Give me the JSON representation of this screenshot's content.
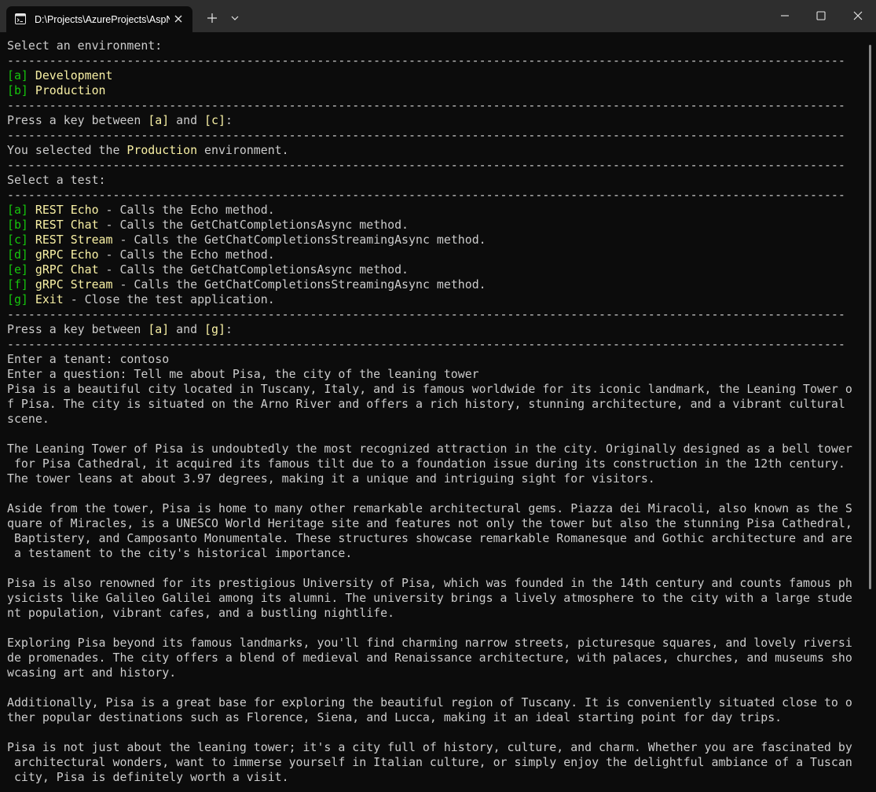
{
  "window": {
    "tab_title": "D:\\Projects\\AzureProjects\\AspNetCore.Chat",
    "icons": {
      "tab": "terminal-icon",
      "tab_close": "close-icon",
      "new_tab": "plus-icon",
      "dropdown": "chevron-down-icon",
      "minimize": "minimize-icon",
      "maximize": "maximize-icon",
      "close": "close-icon"
    },
    "colors": {
      "titlebar": "#2e2e2e",
      "background": "#0c0c0c",
      "text": "#cccccc",
      "key": "#16c60c",
      "highlight": "#f9f1a5"
    }
  },
  "console": {
    "separator": "-----------------------------------------------------------------------------------------------------------------------",
    "env_prompt": "Select an environment:",
    "environments": [
      {
        "key": "[a]",
        "name": "Development"
      },
      {
        "key": "[b]",
        "name": "Production"
      }
    ],
    "env_key_prompt": {
      "before": "Press a key between ",
      "first": "[a]",
      "mid": " and ",
      "last": "[c]",
      "after": ":"
    },
    "selected_env": {
      "before": "You selected the ",
      "value": "Production",
      "after": " environment."
    },
    "test_prompt": "Select a test:",
    "tests": [
      {
        "key": "[a]",
        "name": "REST Echo",
        "desc": " - Calls the Echo method."
      },
      {
        "key": "[b]",
        "name": "REST Chat",
        "desc": " - Calls the GetChatCompletionsAsync method."
      },
      {
        "key": "[c]",
        "name": "REST Stream",
        "desc": " - Calls the GetChatCompletionsStreamingAsync method."
      },
      {
        "key": "[d]",
        "name": "gRPC Echo",
        "desc": " - Calls the Echo method."
      },
      {
        "key": "[e]",
        "name": "gRPC Chat",
        "desc": " - Calls the GetChatCompletionsAsync method."
      },
      {
        "key": "[f]",
        "name": "gRPC Stream",
        "desc": " - Calls the GetChatCompletionsStreamingAsync method."
      },
      {
        "key": "[g]",
        "name": "Exit",
        "desc": " - Close the test application."
      }
    ],
    "test_key_prompt": {
      "before": "Press a key between ",
      "first": "[a]",
      "mid": " and ",
      "last": "[g]",
      "after": ":"
    },
    "tenant_line": "Enter a tenant: contoso",
    "question_line": "Enter a question: Tell me about Pisa, the city of the leaning tower",
    "answer_lines": [
      "Pisa is a beautiful city located in Tuscany, Italy, and is famous worldwide for its iconic landmark, the Leaning Tower o",
      "f Pisa. The city is situated on the Arno River and offers a rich history, stunning architecture, and a vibrant cultural",
      "scene.",
      "",
      "The Leaning Tower of Pisa is undoubtedly the most recognized attraction in the city. Originally designed as a bell tower",
      " for Pisa Cathedral, it acquired its famous tilt due to a foundation issue during its construction in the 12th century.",
      "The tower leans at about 3.97 degrees, making it a unique and intriguing sight for visitors.",
      "",
      "Aside from the tower, Pisa is home to many other remarkable architectural gems. Piazza dei Miracoli, also known as the S",
      "quare of Miracles, is a UNESCO World Heritage site and features not only the tower but also the stunning Pisa Cathedral,",
      " Baptistery, and Camposanto Monumentale. These structures showcase remarkable Romanesque and Gothic architecture and are",
      " a testament to the city's historical importance.",
      "",
      "Pisa is also renowned for its prestigious University of Pisa, which was founded in the 14th century and counts famous ph",
      "ysicists like Galileo Galilei among its alumni. The university brings a lively atmosphere to the city with a large stude",
      "nt population, vibrant cafes, and a bustling nightlife.",
      "",
      "Exploring Pisa beyond its famous landmarks, you'll find charming narrow streets, picturesque squares, and lovely riversi",
      "de promenades. The city offers a blend of medieval and Renaissance architecture, with palaces, churches, and museums sho",
      "wcasing art and history.",
      "",
      "Additionally, Pisa is a great base for exploring the beautiful region of Tuscany. It is conveniently situated close to o",
      "ther popular destinations such as Florence, Siena, and Lucca, making it an ideal starting point for day trips.",
      "",
      "Pisa is not just about the leaning tower; it's a city full of history, culture, and charm. Whether you are fascinated by",
      " architectural wonders, want to immerse yourself in Italian culture, or simply enjoy the delightful ambiance of a Tuscan",
      " city, Pisa is definitely worth a visit."
    ]
  }
}
